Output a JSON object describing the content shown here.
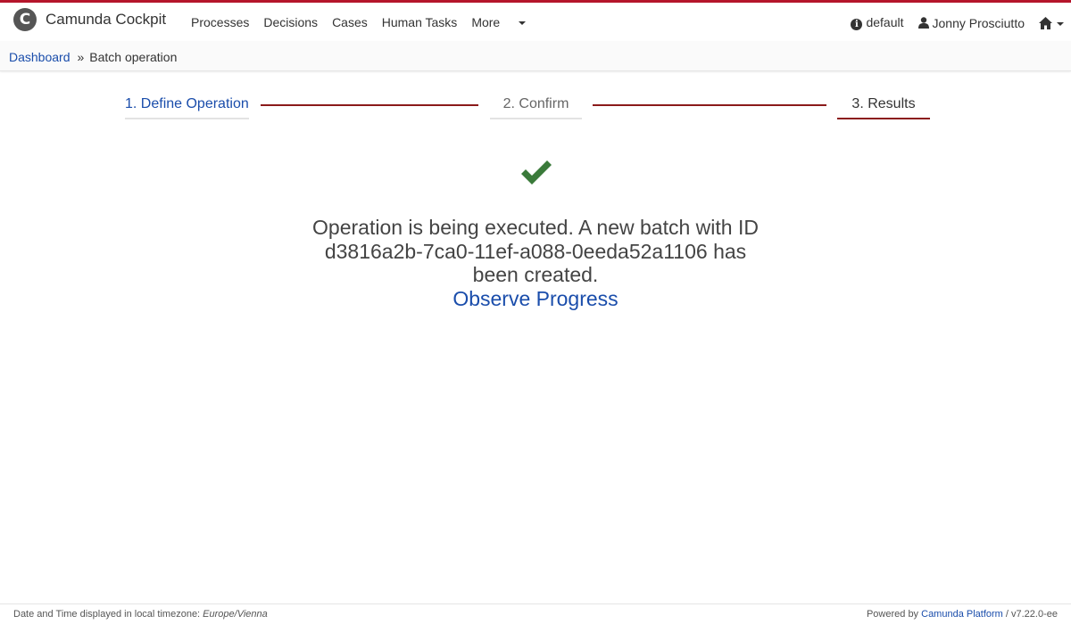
{
  "header": {
    "brand": "Camunda Cockpit",
    "nav": [
      "Processes",
      "Decisions",
      "Cases",
      "Human Tasks"
    ],
    "more_label": "More",
    "engine": "default",
    "user": "Jonny Prosciutto",
    "accent_color": "#b5152b"
  },
  "breadcrumb": {
    "root": "Dashboard",
    "separator": "»",
    "current": "Batch operation"
  },
  "steps": [
    {
      "label": "1. Define Operation",
      "state": "done"
    },
    {
      "label": "2. Confirm",
      "state": "done"
    },
    {
      "label": "3. Results",
      "state": "active"
    }
  ],
  "result": {
    "icon": "check-icon",
    "line1": "Operation is being executed. A new batch with ID",
    "line2": "d3816a2b-7ca0-11ef-a088-0eeda52a1106 has",
    "line3": "been created.",
    "link": "Observe Progress",
    "check_color": "#3a7a3a"
  },
  "footer": {
    "tz_prefix": "Date and Time displayed in local timezone: ",
    "tz": "Europe/Vienna",
    "powered_prefix": "Powered by ",
    "powered_link": "Camunda Platform",
    "version": " / v7.22.0-ee"
  }
}
